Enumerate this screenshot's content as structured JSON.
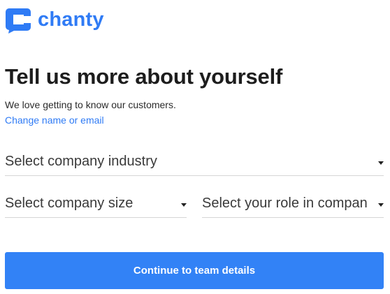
{
  "brand": {
    "name": "chanty",
    "icon": "chanty-logo-icon",
    "color": "#2f7bf5"
  },
  "heading": "Tell us more about yourself",
  "subtext": "We love getting to know our customers.",
  "change_link": "Change name or email",
  "form": {
    "industry_select": {
      "value": "Select company industry",
      "icon": "caret-down-icon"
    },
    "size_select": {
      "value": "Select company size",
      "icon": "caret-down-icon"
    },
    "role_select": {
      "value": "Select your role in compan",
      "icon": "caret-down-icon"
    }
  },
  "continue_button": {
    "label": "Continue to team details",
    "color": "#3282f6"
  }
}
